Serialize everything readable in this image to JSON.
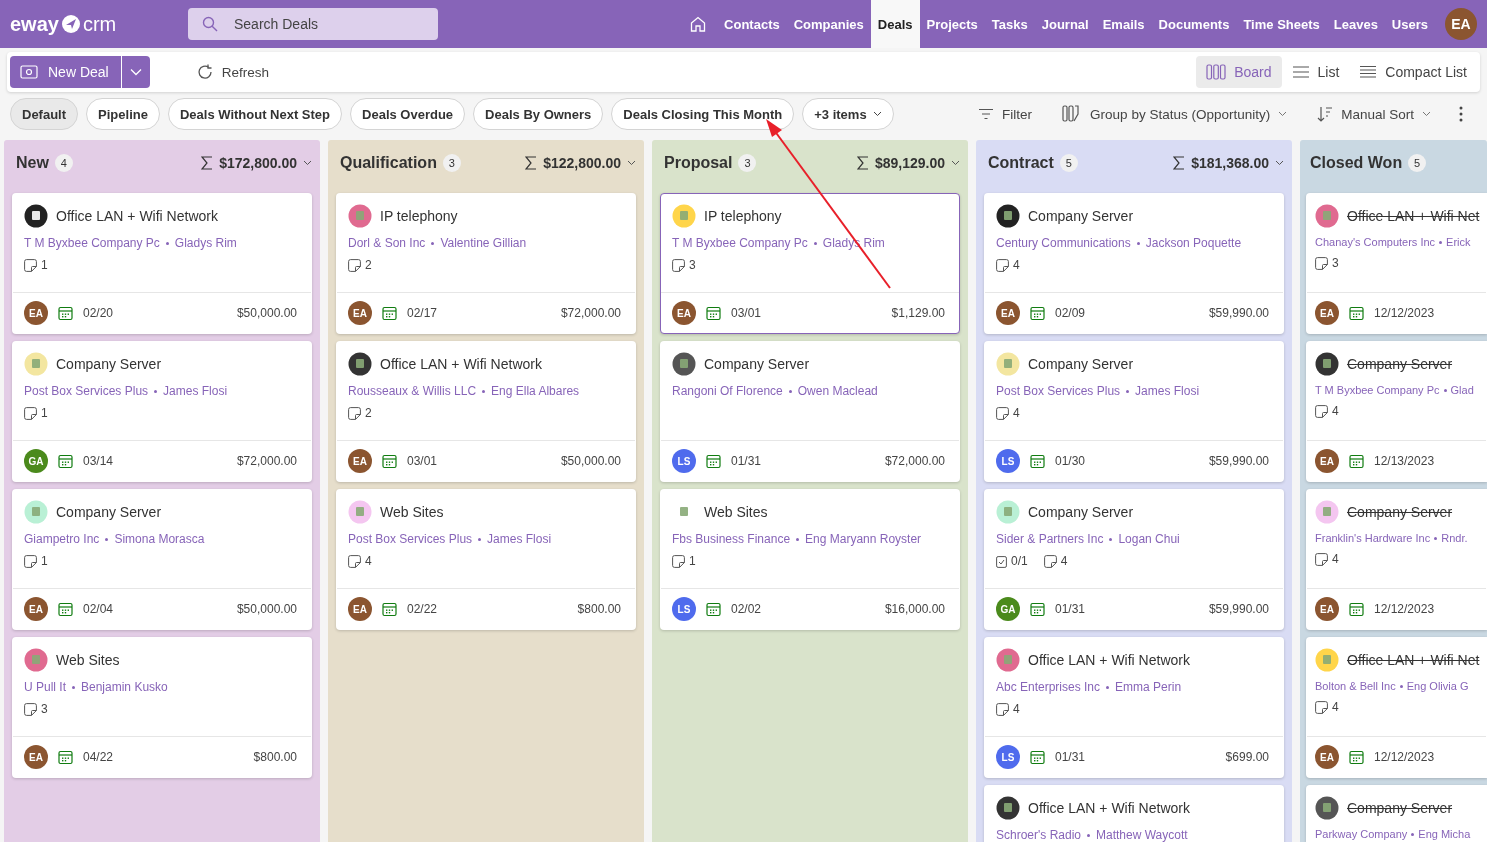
{
  "app_logo": {
    "left": "eway",
    "right": "crm"
  },
  "search": {
    "placeholder": "Search Deals"
  },
  "nav": [
    {
      "label": "Contacts",
      "selected": false
    },
    {
      "label": "Companies",
      "selected": false
    },
    {
      "label": "Deals",
      "selected": true
    },
    {
      "label": "Projects",
      "selected": false
    },
    {
      "label": "Tasks",
      "selected": false
    },
    {
      "label": "Journal",
      "selected": false
    },
    {
      "label": "Emails",
      "selected": false
    },
    {
      "label": "Documents",
      "selected": false
    },
    {
      "label": "Time Sheets",
      "selected": false
    },
    {
      "label": "Leaves",
      "selected": false
    },
    {
      "label": "Users",
      "selected": false
    }
  ],
  "user": {
    "initials": "EA"
  },
  "toolbar": {
    "new_button": "New Deal",
    "refresh": "Refresh",
    "views": [
      {
        "label": "Board",
        "kind": "board",
        "selected": true
      },
      {
        "label": "List",
        "kind": "list",
        "selected": false
      },
      {
        "label": "Compact List",
        "kind": "compact",
        "selected": false
      }
    ]
  },
  "saved_views": [
    {
      "label": "Default",
      "selected": true
    },
    {
      "label": "Pipeline",
      "selected": false
    },
    {
      "label": "Deals Without Next Step",
      "selected": false
    },
    {
      "label": "Deals Overdue",
      "selected": false
    },
    {
      "label": "Deals By Owners",
      "selected": false
    },
    {
      "label": "Deals Closing This Month",
      "selected": false
    }
  ],
  "more_views": "+3 items",
  "view_options": [
    {
      "label": "Filter",
      "kind": "filter"
    },
    {
      "label": "Group by Status (Opportunity)",
      "kind": "group"
    },
    {
      "label": "Manual Sort",
      "kind": "sort"
    }
  ],
  "columns": [
    {
      "name": "New",
      "count": "4",
      "sum": "$172,800.00",
      "color": "#e3cde6",
      "cards": [
        {
          "title": "Office LAN + Wifi Network",
          "company": "T M Byxbee Company Pc",
          "contact": "Gladys Rim",
          "notes": "1",
          "owner": {
            "initials": "EA",
            "color": "#8b5530"
          },
          "date": "02/20",
          "amount": "$50,000.00",
          "selected": false,
          "closed": false
        },
        {
          "title": "Company Server",
          "company": "Post Box Services Plus",
          "contact": "James Flosi",
          "notes": "1",
          "owner": {
            "initials": "GA",
            "color": "#4b8a1c"
          },
          "date": "03/14",
          "amount": "$72,000.00",
          "selected": false,
          "closed": false
        },
        {
          "title": "Company Server",
          "company": "Giampetro Inc",
          "contact": "Simona Morasca",
          "notes": "1",
          "owner": {
            "initials": "EA",
            "color": "#8b5530"
          },
          "date": "02/04",
          "amount": "$50,000.00",
          "selected": false,
          "closed": false
        },
        {
          "title": "Web Sites",
          "company": "U Pull It",
          "contact": "Benjamin Kusko",
          "notes": "3",
          "owner": {
            "initials": "EA",
            "color": "#8b5530"
          },
          "date": "04/22",
          "amount": "$800.00",
          "selected": false,
          "closed": false
        }
      ]
    },
    {
      "name": "Qualification",
      "count": "3",
      "sum": "$122,800.00",
      "color": "#e6decb",
      "cards": [
        {
          "title": "IP telephony",
          "company": "Dorl & Son Inc",
          "contact": "Valentine Gillian",
          "notes": "2",
          "owner": {
            "initials": "EA",
            "color": "#8b5530"
          },
          "date": "02/17",
          "amount": "$72,000.00",
          "selected": false,
          "closed": false
        },
        {
          "title": "Office LAN + Wifi Network",
          "company": "Rousseaux & Willis LLC",
          "contact": "Eng Ella Albares",
          "notes": "2",
          "owner": {
            "initials": "EA",
            "color": "#8b5530"
          },
          "date": "03/01",
          "amount": "$50,000.00",
          "selected": false,
          "closed": false
        },
        {
          "title": "Web Sites",
          "company": "Post Box Services Plus",
          "contact": "James Flosi",
          "notes": "4",
          "owner": {
            "initials": "EA",
            "color": "#8b5530"
          },
          "date": "02/22",
          "amount": "$800.00",
          "selected": false,
          "closed": false
        }
      ]
    },
    {
      "name": "Proposal",
      "count": "3",
      "sum": "$89,129.00",
      "color": "#d9e3cb",
      "cards": [
        {
          "title": "IP telephony",
          "company": "T M Byxbee Company Pc",
          "contact": "Gladys Rim",
          "notes": "3",
          "owner": {
            "initials": "EA",
            "color": "#8b5530"
          },
          "date": "03/01",
          "amount": "$1,129.00",
          "selected": true,
          "closed": false
        },
        {
          "title": "Company Server",
          "company": "Rangoni Of Florence",
          "contact": "Owen Maclead",
          "owner": {
            "initials": "LS",
            "color": "#4f6bed"
          },
          "date": "01/31",
          "amount": "$72,000.00",
          "selected": false,
          "closed": false
        },
        {
          "title": "Web Sites",
          "company": "Fbs Business Finance",
          "contact": "Eng Maryann Royster",
          "notes": "1",
          "owner": {
            "initials": "LS",
            "color": "#4f6bed"
          },
          "date": "02/02",
          "amount": "$16,000.00",
          "selected": false,
          "closed": false
        }
      ]
    },
    {
      "name": "Contract",
      "count": "5",
      "sum": "$181,368.00",
      "color": "#d9dcf4",
      "cards": [
        {
          "title": "Company Server",
          "company": "Century Communications",
          "contact": "Jackson Poquette",
          "notes": "4",
          "owner": {
            "initials": "EA",
            "color": "#8b5530"
          },
          "date": "02/09",
          "amount": "$59,990.00",
          "selected": false,
          "closed": false
        },
        {
          "title": "Company Server",
          "company": "Post Box Services Plus",
          "contact": "James Flosi",
          "notes": "4",
          "owner": {
            "initials": "LS",
            "color": "#4f6bed"
          },
          "date": "01/30",
          "amount": "$59,990.00",
          "selected": false,
          "closed": false
        },
        {
          "title": "Company Server",
          "company": "Sider & Partners Inc",
          "contact": "Logan Chui",
          "tasks": "0/1",
          "notes": "4",
          "owner": {
            "initials": "GA",
            "color": "#4b8a1c"
          },
          "date": "01/31",
          "amount": "$59,990.00",
          "selected": false,
          "closed": false
        },
        {
          "title": "Office LAN + Wifi Network",
          "company": "Abc Enterprises Inc",
          "contact": "Emma Perin",
          "notes": "4",
          "owner": {
            "initials": "LS",
            "color": "#4f6bed"
          },
          "date": "01/31",
          "amount": "$699.00",
          "selected": false,
          "closed": false
        },
        {
          "title": "Office LAN + Wifi Network",
          "company": "Schroer's Radio",
          "contact": "Matthew Waycott",
          "selected": false,
          "closed": false
        }
      ]
    },
    {
      "name": "Closed Won",
      "count": "5",
      "color": "#c9d8e2",
      "cards": [
        {
          "title": "Office LAN + Wifi Net",
          "company": "Chanay's Computers Inc",
          "contact": "Erick",
          "notes": "3",
          "owner": {
            "initials": "EA",
            "color": "#8b5530"
          },
          "date": "12/12/2023",
          "selected": false,
          "closed": true
        },
        {
          "title": "Company Server",
          "company": "T M Byxbee Company Pc",
          "contact": "Glad",
          "notes": "4",
          "owner": {
            "initials": "EA",
            "color": "#8b5530"
          },
          "date": "12/13/2023",
          "selected": false,
          "closed": true
        },
        {
          "title": "Company Server",
          "company": "Franklin's Hardware Inc",
          "contact": "Rndr.",
          "notes": "4",
          "owner": {
            "initials": "EA",
            "color": "#8b5530"
          },
          "date": "12/12/2023",
          "selected": false,
          "closed": true
        },
        {
          "title": "Office LAN + Wifi Net",
          "company": "Bolton & Bell Inc",
          "contact": "Eng Olivia G",
          "notes": "4",
          "owner": {
            "initials": "EA",
            "color": "#8b5530"
          },
          "date": "12/12/2023",
          "selected": false,
          "closed": true
        },
        {
          "title": "Company Server",
          "company": "Parkway Company",
          "contact": "Eng Micha",
          "selected": false,
          "closed": true
        }
      ]
    }
  ]
}
